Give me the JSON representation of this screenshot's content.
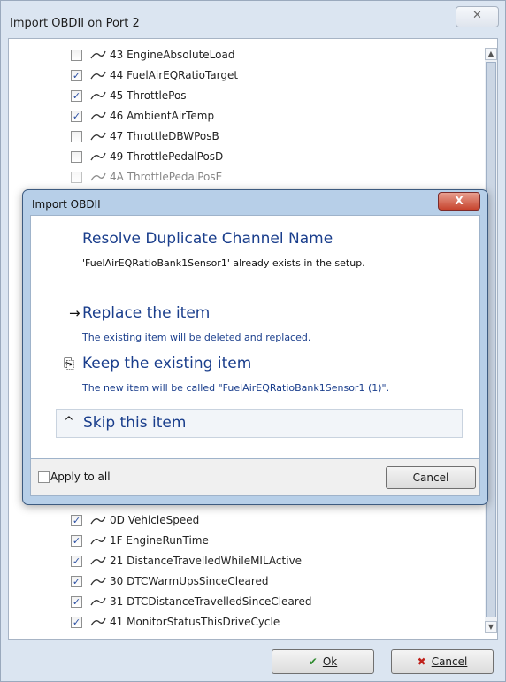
{
  "outer": {
    "title": "Import OBDII on Port 2",
    "close_glyph": "✕",
    "ok_label": "Ok",
    "ok_icon": "check-icon",
    "cancel_label": "Cancel",
    "cancel_icon": "x-icon"
  },
  "top_items": [
    {
      "label": "43 EngineAbsoluteLoad",
      "checked": false
    },
    {
      "label": "44 FuelAirEQRatioTarget",
      "checked": true
    },
    {
      "label": "45 ThrottlePos",
      "checked": true
    },
    {
      "label": "46 AmbientAirTemp",
      "checked": true
    },
    {
      "label": "47 ThrottleDBWPosB",
      "checked": false
    },
    {
      "label": "49 ThrottlePedalPosD",
      "checked": false
    },
    {
      "label": "4A ThrottlePedalPosE",
      "checked": false
    }
  ],
  "bottom_items": [
    {
      "label": "0D VehicleSpeed",
      "checked": true
    },
    {
      "label": "1F EngineRunTime",
      "checked": true
    },
    {
      "label": "21 DistanceTravelledWhileMILActive",
      "checked": true
    },
    {
      "label": "30 DTCWarmUpsSinceCleared",
      "checked": true
    },
    {
      "label": "31 DTCDistanceTravelledSinceCleared",
      "checked": true
    },
    {
      "label": "41 MonitorStatusThisDriveCycle",
      "checked": true
    }
  ],
  "dialog": {
    "title": "Import OBDII",
    "close_glyph": "X",
    "heading": "Resolve Duplicate Channel Name",
    "message": "'FuelAirEQRatioBank1Sensor1' already exists in the setup.",
    "replace": {
      "icon": "arrow-right-icon",
      "glyph": "→",
      "title": "Replace the item",
      "subtitle": "The existing item will be deleted and replaced."
    },
    "keep": {
      "icon": "copy-icon",
      "glyph": "⎘",
      "title": "Keep the existing item",
      "subtitle": "The new item will be called \"FuelAirEQRatioBank1Sensor1 (1)\"."
    },
    "skip": {
      "icon": "chevron-up-icon",
      "glyph": "^",
      "title": "Skip this item"
    },
    "apply_all_label": "Apply to all",
    "apply_all_checked": false,
    "cancel_label": "Cancel"
  },
  "colors": {
    "link_blue": "#1a3e8c",
    "dialog_frame": "#b7cfe8",
    "close_red": "#c7442e",
    "ok_green": "#2e8b2e",
    "cancel_red": "#c0201a"
  }
}
